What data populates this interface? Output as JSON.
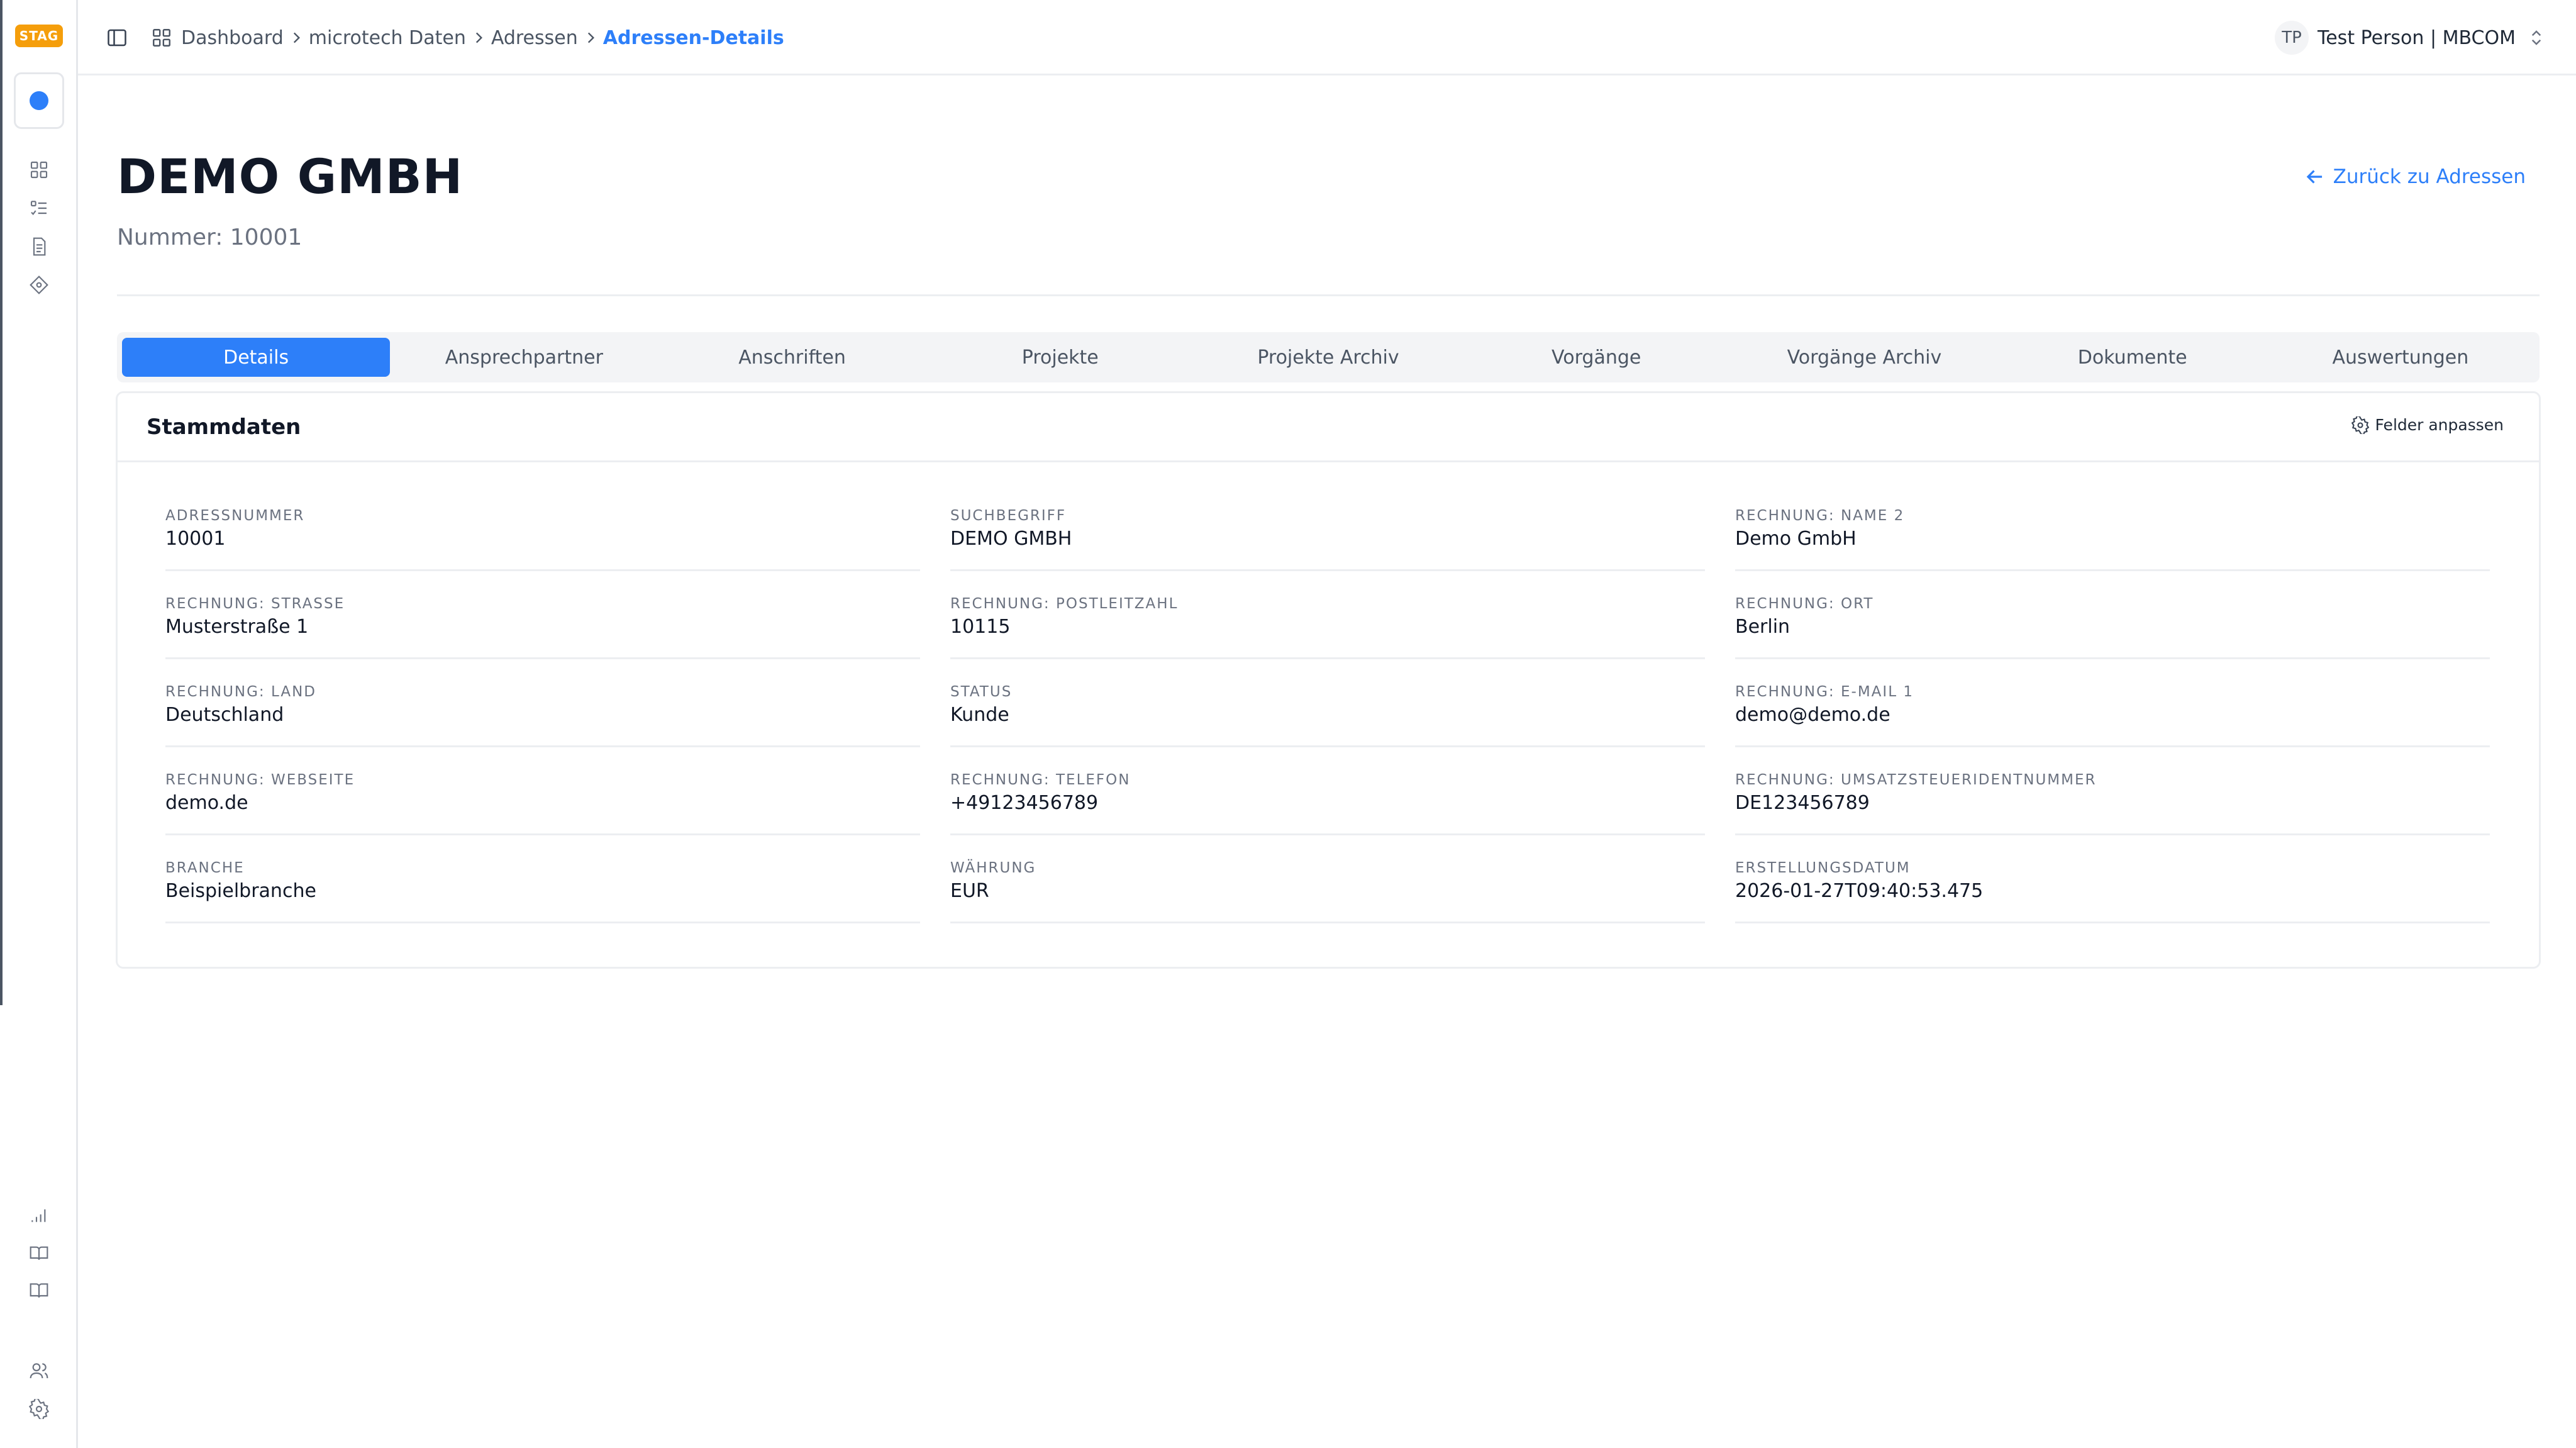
{
  "app": {
    "env_badge": "STAG",
    "accent": "#2d7ff9",
    "badge_color": "#f59e0b"
  },
  "rail": {
    "icons": [
      "dashboard-icon",
      "list-icon",
      "document-icon",
      "tag-icon",
      "chart-icon",
      "book-icon",
      "book-open-icon",
      "users-icon",
      "settings-icon"
    ]
  },
  "breadcrumb": {
    "items": [
      "Dashboard",
      "microtech Daten",
      "Adressen",
      "Adressen-Details"
    ]
  },
  "user": {
    "initials": "TP",
    "name": "Test Person | MBCOM"
  },
  "page": {
    "title": "DEMO GMBH",
    "subtitle": "Nummer: 10001",
    "back_label": "Zurück zu Adressen"
  },
  "tabs": [
    {
      "label": "Details",
      "active": true
    },
    {
      "label": "Ansprechpartner",
      "active": false
    },
    {
      "label": "Anschriften",
      "active": false
    },
    {
      "label": "Projekte",
      "active": false
    },
    {
      "label": "Projekte Archiv",
      "active": false
    },
    {
      "label": "Vorgänge",
      "active": false
    },
    {
      "label": "Vorgänge Archiv",
      "active": false
    },
    {
      "label": "Dokumente",
      "active": false
    },
    {
      "label": "Auswertungen",
      "active": false
    }
  ],
  "card": {
    "title": "Stammdaten",
    "action_label": "Felder anpassen",
    "fields": [
      {
        "label": "Adressnummer",
        "value": "10001"
      },
      {
        "label": "Suchbegriff",
        "value": "DEMO GMBH"
      },
      {
        "label": "Rechnung: Name 2",
        "value": "Demo GmbH"
      },
      {
        "label": "Rechnung: Strasse",
        "value": "Musterstraße 1"
      },
      {
        "label": "Rechnung: Postleitzahl",
        "value": "10115"
      },
      {
        "label": "Rechnung: Ort",
        "value": "Berlin"
      },
      {
        "label": "Rechnung: Land",
        "value": "Deutschland"
      },
      {
        "label": "Status",
        "value": "Kunde"
      },
      {
        "label": "Rechnung: E-Mail 1",
        "value": "demo@demo.de"
      },
      {
        "label": "Rechnung: Webseite",
        "value": "demo.de"
      },
      {
        "label": "Rechnung: Telefon",
        "value": "+49123456789"
      },
      {
        "label": "Rechnung: Umsatzsteueridentnummer",
        "value": "DE123456789"
      },
      {
        "label": "Branche",
        "value": "Beispielbranche"
      },
      {
        "label": "Währung",
        "value": "EUR"
      },
      {
        "label": "Erstellungsdatum",
        "value": "2026-01-27T09:40:53.475"
      }
    ]
  }
}
